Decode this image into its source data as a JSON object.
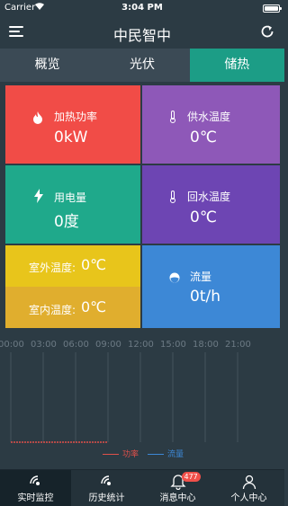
{
  "status_bar": {
    "carrier": "Carrier",
    "time": "3:04 PM"
  },
  "header": {
    "title": "中民智中"
  },
  "tabs": [
    {
      "label": "概览"
    },
    {
      "label": "光伏"
    },
    {
      "label": "储热",
      "active": true
    }
  ],
  "cards": {
    "heating_power": {
      "label": "加热功率",
      "value": "0kW",
      "color": "#f14c47",
      "icon": "flame-icon"
    },
    "supply_temp": {
      "label": "供水温度",
      "value": "0℃",
      "color": "#8e58b8",
      "icon": "thermometer-icon"
    },
    "electricity": {
      "label": "用电量",
      "value": "0度",
      "color": "#1fa98b",
      "icon": "lightning-icon"
    },
    "return_temp": {
      "label": "回水温度",
      "value": "0℃",
      "color": "#6d45b3",
      "icon": "thermometer-icon"
    },
    "outdoor_temp": {
      "label": "室外温度:",
      "value": "0℃",
      "color": "#e8c51b"
    },
    "indoor_temp": {
      "label": "室内温度:",
      "value": "0℃",
      "color": "#e0ae2e"
    },
    "flow": {
      "label": "流量",
      "value": "0t/h",
      "color": "#3d88d6",
      "icon": "droplet-icon"
    }
  },
  "chart_data": {
    "type": "line",
    "x_ticks": [
      "00:00",
      "03:00",
      "06:00",
      "09:00",
      "12:00",
      "15:00",
      "18:00",
      "21:00"
    ],
    "series": [
      {
        "name": "功率",
        "color": "#e0504a",
        "values": [
          0,
          0,
          0,
          0
        ]
      },
      {
        "name": "流量",
        "color": "#3d88d6",
        "values": []
      }
    ],
    "grid": true
  },
  "bottom_nav": [
    {
      "label": "实时监控",
      "icon": "monitor-icon",
      "active": true
    },
    {
      "label": "历史统计",
      "icon": "history-icon"
    },
    {
      "label": "消息中心",
      "icon": "bell-icon",
      "badge": "477"
    },
    {
      "label": "个人中心",
      "icon": "user-icon"
    }
  ]
}
